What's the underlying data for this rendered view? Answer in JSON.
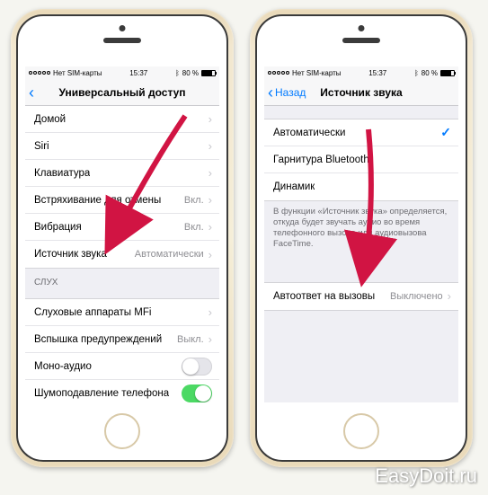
{
  "status": {
    "carrier": "Нет SIM-карты",
    "time": "15:37",
    "bt_icon": "bluetooth-icon",
    "battery_pct": "80 %"
  },
  "phone1": {
    "nav": {
      "back_glyph": "‹",
      "title": "Универсальный доступ"
    },
    "rows": {
      "home": "Домой",
      "siri": "Siri",
      "keyboard": "Клавиатура",
      "shake_undo": "Встряхивание для отмены",
      "shake_val": "Вкл.",
      "vibration": "Вибрация",
      "vibration_val": "Вкл.",
      "audio_src": "Источник звука",
      "audio_src_val": "Автоматически"
    },
    "section_hearing": "слух",
    "rows2": {
      "mfi": "Слуховые аппараты MFi",
      "flash": "Вспышка предупреждений",
      "flash_val": "Выкл.",
      "mono": "Моно-аудио",
      "noise": "Шумоподавление телефона"
    }
  },
  "phone2": {
    "nav": {
      "back_glyph": "‹",
      "back_label": "Назад",
      "title": "Источник звука"
    },
    "rows": {
      "auto": "Автоматически",
      "bt": "Гарнитура Bluetooth",
      "speaker": "Динамик"
    },
    "footer": "В функции «Источник звука» определяется, откуда будет звучать аудио во время телефонного вызова или аудиовызова FaceTime.",
    "rows2": {
      "auto_answer": "Автоответ на вызовы",
      "auto_answer_val": "Выключено"
    }
  },
  "watermark": "EasyDoit.ru"
}
